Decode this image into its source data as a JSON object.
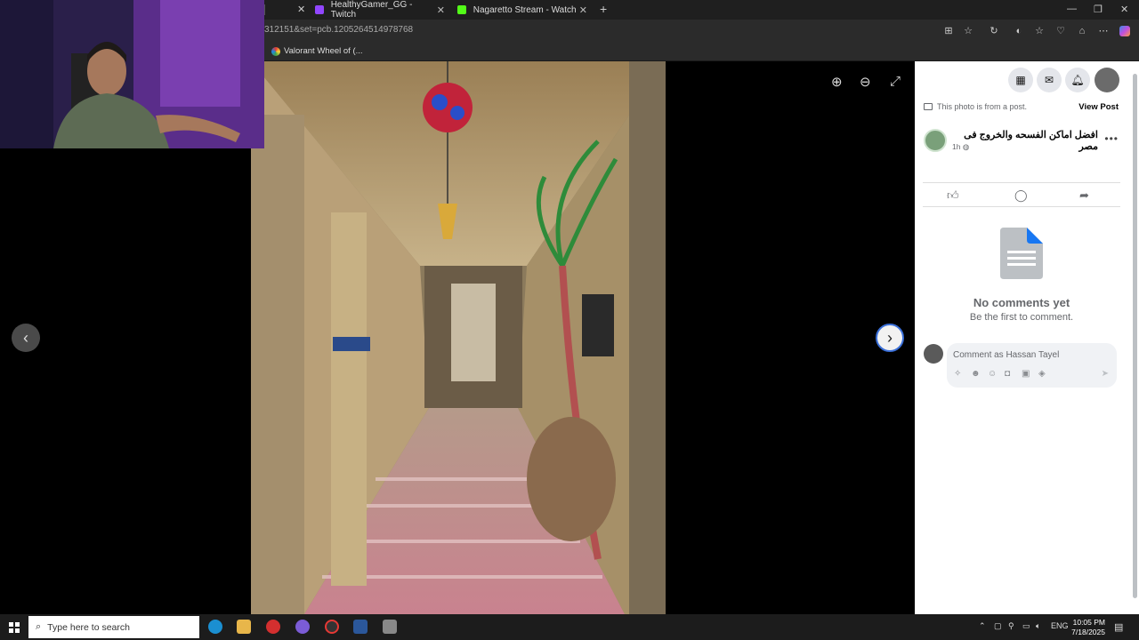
{
  "browser": {
    "tabs": [
      {
        "label": "HealthyGamer_GG - Twitch",
        "favicon_color": "#9146ff"
      },
      {
        "label": "Nagaretto Stream - Watch Live o",
        "favicon_color": "#53fc18"
      }
    ],
    "new_tab_label": "+",
    "url": "312151&set=pcb.1205264514978768",
    "bookmark": "Valorant Wheel of (..."
  },
  "viewer": {
    "prev_label": "‹",
    "next_label": "›"
  },
  "post": {
    "from_post_text": "This photo is from a post.",
    "view_post_label": "View Post",
    "title": "افضل اماكن الفسحه والخروج فى مصر",
    "time": "1h",
    "no_comments_title": "No comments yet",
    "no_comments_sub": "Be the first to comment.",
    "comment_placeholder": "Comment as Hassan Tayel"
  },
  "taskbar": {
    "search_placeholder": "Type here to search",
    "language": "ENG",
    "time": "10:05 PM",
    "date": "7/18/2025",
    "notification_count": "3"
  },
  "colors": {
    "facebook_panel_bg": "#ffffff",
    "viewer_bg": "#000000",
    "accent_blue": "#3a6fd8"
  }
}
